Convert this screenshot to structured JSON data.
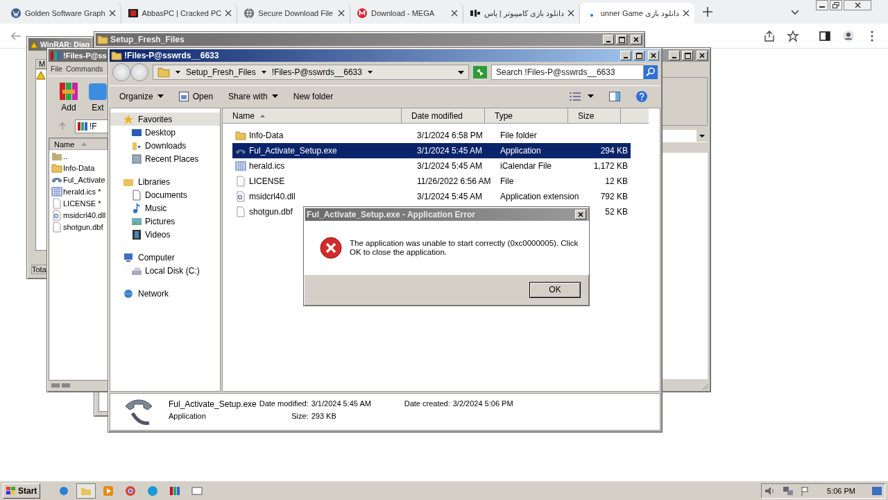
{
  "browser": {
    "tabs": [
      {
        "title": "Golden Software Graph",
        "selected": false
      },
      {
        "title": "AbbasPC | Cracked PC",
        "selected": false
      },
      {
        "title": "Secure Download File",
        "selected": false
      },
      {
        "title": "Download - MEGA",
        "selected": false
      },
      {
        "title": "دانلود بازی کامپیوتر | یاس",
        "selected": false
      },
      {
        "title": "دانلود بازی unner Game",
        "selected": true
      }
    ]
  },
  "winrar_diagnostic": {
    "title": "WinRAR: Diag",
    "column": "M",
    "status": "Tota"
  },
  "setup_window": {
    "title": "Setup_Fresh_Files"
  },
  "winrar_main": {
    "title": "!Files-P@ss",
    "menu": [
      "File",
      "Commands"
    ],
    "tools": [
      "Add",
      "Ext"
    ],
    "path": "!F",
    "column": "Name",
    "files": [
      {
        "name": "..",
        "kind": "up"
      },
      {
        "name": "Info-Data",
        "kind": "folder"
      },
      {
        "name": "Ful_Activate",
        "kind": "exe"
      },
      {
        "name": "herald.ics *",
        "kind": "calendar"
      },
      {
        "name": "LICENSE *",
        "kind": "file"
      },
      {
        "name": "msidcrl40.dll",
        "kind": "dll"
      },
      {
        "name": "shotgun.dbf",
        "kind": "file"
      }
    ]
  },
  "explorer": {
    "title": "!Files-P@sswrds__6633",
    "breadcrumb": [
      "Setup_Fresh_Files",
      "!Files-P@sswrds__6633"
    ],
    "search": {
      "placeholder": "Search !Files-P@sswrds__6633"
    },
    "commands": [
      {
        "label": "Organize",
        "dropdown": true
      },
      {
        "label": "Open",
        "dropdown": false
      },
      {
        "label": "Share with",
        "dropdown": true
      },
      {
        "label": "New folder",
        "dropdown": false
      }
    ],
    "nav": [
      {
        "label": "Favorites",
        "children": [
          {
            "label": "Desktop"
          },
          {
            "label": "Downloads"
          },
          {
            "label": "Recent Places"
          }
        ]
      },
      {
        "label": "Libraries",
        "children": [
          {
            "label": "Documents"
          },
          {
            "label": "Music"
          },
          {
            "label": "Pictures"
          },
          {
            "label": "Videos"
          }
        ]
      },
      {
        "label": "Computer",
        "children": [
          {
            "label": "Local Disk (C:)"
          }
        ]
      },
      {
        "label": "Network"
      }
    ],
    "columns": [
      {
        "label": "Name",
        "sorted": true
      },
      {
        "label": "Date modified",
        "sorted": false
      },
      {
        "label": "Type",
        "sorted": false
      },
      {
        "label": "Size",
        "sorted": false
      }
    ],
    "rows": [
      {
        "name": "Info-Data",
        "date": "3/1/2024 6:58 PM",
        "type": "File folder",
        "kind": "folder",
        "selected": false
      },
      {
        "name": "Ful_Activate_Setup.exe",
        "date": "3/1/2024 5:45 AM",
        "type": "Application",
        "size": "294 KB",
        "kind": "exe",
        "selected": true
      },
      {
        "name": "herald.ics",
        "date": "3/1/2024 5:45 AM",
        "type": "iCalendar File",
        "size": "1,172 KB",
        "kind": "calendar",
        "selected": false
      },
      {
        "name": "LICENSE",
        "date": "11/26/2022 6:56 AM",
        "type": "File",
        "size": "12 KB",
        "kind": "file",
        "selected": false
      },
      {
        "name": "msidcrl40.dll",
        "date": "3/1/2024 5:45 AM",
        "type": "Application extension",
        "size": "792 KB",
        "kind": "dll",
        "selected": false
      },
      {
        "name": "shotgun.dbf",
        "size": "52 KB",
        "kind": "file",
        "selected": false
      }
    ],
    "details": {
      "name": "Ful_Activate_Setup.exe",
      "type": "Application",
      "modified_label": "Date modified:",
      "modified": "3/1/2024 5:45 AM",
      "size_label": "Size:",
      "size": "293 KB",
      "created_label": "Date created:",
      "created": "3/2/2024 5:06 PM"
    }
  },
  "error_dialog": {
    "title": "Ful_Activate_Setup.exe - Application Error",
    "message": "The application was unable to start correctly (0xc0000005). Click OK to close the application.",
    "button": "OK"
  },
  "taskbar": {
    "start": "Start",
    "clock": "5:06 PM"
  }
}
